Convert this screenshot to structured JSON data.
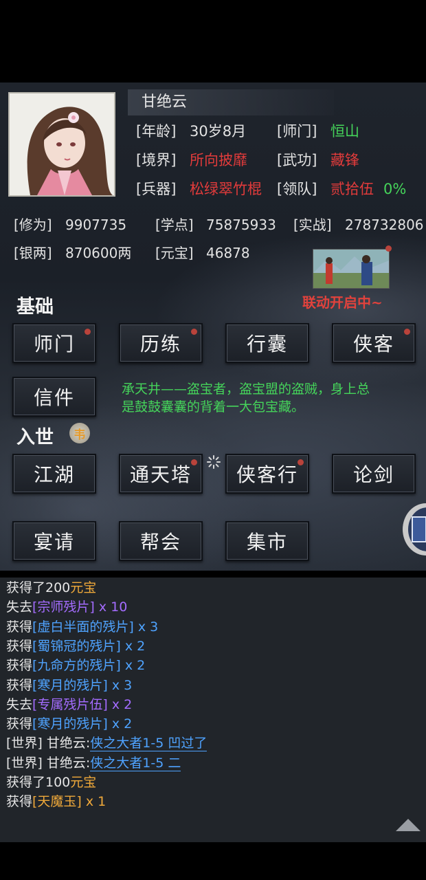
{
  "character": {
    "name": "甘绝云",
    "rows": [
      {
        "l1": "[年龄]",
        "v1": "30岁8月",
        "l2": "[师门]",
        "v2": "恒山"
      },
      {
        "l1": "[境界]",
        "v1": "所向披靡",
        "l2": "[武功]",
        "v2": "藏锋"
      },
      {
        "l1": "[兵器]",
        "v1": "松绿翠竹棍",
        "l2": "[领队]",
        "v2": "贰拾伍",
        "v2b": "0%"
      }
    ],
    "stats": [
      {
        "label": "[修为]",
        "value": "9907735"
      },
      {
        "label": "[学点]",
        "value": "75875933"
      },
      {
        "label": "[实战]",
        "value": "278732806"
      },
      {
        "label": "[银两]",
        "value": "870600两"
      },
      {
        "label": "[元宝]",
        "value": "46878"
      }
    ]
  },
  "event": {
    "label": "联动开启中~"
  },
  "sections": {
    "basic": "基础",
    "world": "入世",
    "world_badge": "韦"
  },
  "basic_buttons": [
    "师门",
    "历练",
    "行囊",
    "侠客",
    "信件"
  ],
  "world_buttons": [
    "江湖",
    "通天塔",
    "侠客行",
    "论剑",
    "宴请",
    "帮会",
    "集市"
  ],
  "tip": {
    "line1": "承天井——盗宝者，盗宝盟的盗贼，身上总",
    "line2": "是鼓鼓囊囊的背着一大包宝藏。"
  },
  "log": [
    [
      {
        "t": "获得了200",
        "c": ""
      },
      {
        "t": "元宝",
        "c": "gold"
      }
    ],
    [
      {
        "t": "失去",
        "c": ""
      },
      {
        "t": "[宗师残片]",
        "c": "purple"
      },
      {
        "t": " x 10",
        "c": "purple"
      }
    ],
    [
      {
        "t": "获得",
        "c": ""
      },
      {
        "t": "[虚白半面的残片]",
        "c": "blue"
      },
      {
        "t": " x 3",
        "c": "blue"
      }
    ],
    [
      {
        "t": "获得",
        "c": ""
      },
      {
        "t": "[蜀锦冠的残片]",
        "c": "blue"
      },
      {
        "t": " x 2",
        "c": "blue"
      }
    ],
    [
      {
        "t": "获得",
        "c": ""
      },
      {
        "t": "[九命方的残片]",
        "c": "blue"
      },
      {
        "t": " x 2",
        "c": "blue"
      }
    ],
    [
      {
        "t": "获得",
        "c": ""
      },
      {
        "t": "[寒月的残片]",
        "c": "blue"
      },
      {
        "t": " x 3",
        "c": "blue"
      }
    ],
    [
      {
        "t": "失去",
        "c": ""
      },
      {
        "t": "[专属残片伍]",
        "c": "purple"
      },
      {
        "t": " x 2",
        "c": "purple"
      }
    ],
    [
      {
        "t": "获得",
        "c": ""
      },
      {
        "t": "[寒月的残片]",
        "c": "blue"
      },
      {
        "t": " x 2",
        "c": "blue"
      }
    ],
    [
      {
        "t": "[世界] 甘绝云:",
        "c": ""
      },
      {
        "t": "侠之大者1-5 凹过了",
        "c": "link"
      }
    ],
    [
      {
        "t": "[世界] 甘绝云:",
        "c": ""
      },
      {
        "t": "侠之大者1-5 二",
        "c": "link"
      }
    ],
    [
      {
        "t": "获得了100",
        "c": ""
      },
      {
        "t": "元宝",
        "c": "gold"
      }
    ],
    [
      {
        "t": "获得",
        "c": ""
      },
      {
        "t": "[天魔玉]",
        "c": "orange"
      },
      {
        "t": " x 1",
        "c": "orange"
      }
    ]
  ]
}
